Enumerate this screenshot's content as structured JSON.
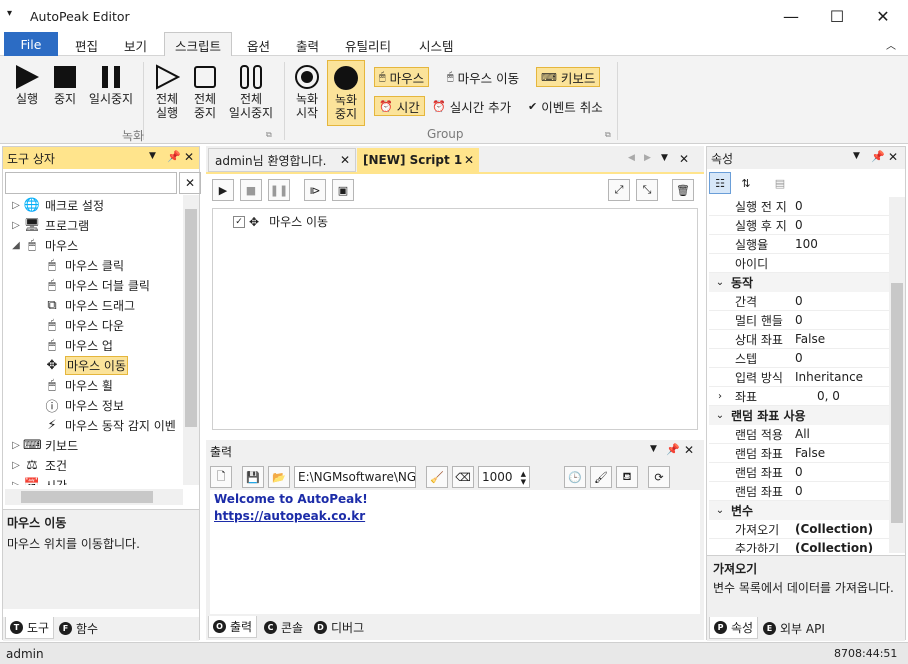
{
  "window": {
    "title": "AutoPeak Editor",
    "minimize": "—",
    "maximize": "☐",
    "close": "✕"
  },
  "menu": {
    "file": "File",
    "items": [
      "편집",
      "보기",
      "스크립트",
      "옵션",
      "출력",
      "유틸리티",
      "시스템"
    ]
  },
  "ribbon": {
    "run": "실행",
    "stop": "중지",
    "pause": "일시중지",
    "run_all": [
      "전체",
      "실행"
    ],
    "stop_all": [
      "전체",
      "중지"
    ],
    "pause_all": [
      "전체",
      "일시중지"
    ],
    "rec_start": [
      "녹화",
      "시작"
    ],
    "rec_stop": [
      "녹화",
      "중지"
    ],
    "group_record": "녹화",
    "mouse": "마우스",
    "mouse_move": "마우스 이동",
    "keyboard": "키보드",
    "time": "시간",
    "realtime_add": "실시간 추가",
    "event_cancel": "이벤트 취소",
    "group_group": "Group"
  },
  "toolbox": {
    "title": "도구 상자",
    "items": [
      {
        "label": "매크로 설정",
        "icon": "globe-icon",
        "level": 0,
        "chev": "▷"
      },
      {
        "label": "프로그램",
        "icon": "program-icon",
        "level": 0,
        "chev": "▷"
      },
      {
        "label": "마우스",
        "icon": "mouse-icon",
        "level": 0,
        "chev": "◢"
      },
      {
        "label": "마우스 클릭",
        "icon": "mouse-click-icon",
        "level": 1
      },
      {
        "label": "마우스 더블 클릭",
        "icon": "mouse-double-click-icon",
        "level": 1
      },
      {
        "label": "마우스 드래그",
        "icon": "mouse-drag-icon",
        "level": 1
      },
      {
        "label": "마우스 다운",
        "icon": "mouse-down-icon",
        "level": 1
      },
      {
        "label": "마우스 업",
        "icon": "mouse-up-icon",
        "level": 1
      },
      {
        "label": "마우스 이동",
        "icon": "move-icon",
        "level": 1,
        "selected": true
      },
      {
        "label": "마우스 휠",
        "icon": "mouse-wheel-icon",
        "level": 1
      },
      {
        "label": "마우스 정보",
        "icon": "mouse-info-icon",
        "level": 1
      },
      {
        "label": "마우스 동작 감지 이벤",
        "icon": "lightning-icon",
        "level": 1
      },
      {
        "label": "키보드",
        "icon": "keyboard-icon",
        "level": 0,
        "chev": "▷"
      },
      {
        "label": "조건",
        "icon": "condition-icon",
        "level": 0,
        "chev": "▷"
      },
      {
        "label": "시간",
        "icon": "calendar-icon",
        "level": 0,
        "chev": "▷"
      }
    ],
    "desc_title": "마우스 이동",
    "desc_text": "마우스 위치를 이동합니다.",
    "tab_tools": "도구",
    "tab_functions": "함수"
  },
  "doc": {
    "tab1": "admin님 환영합니다.",
    "tab2": "[NEW] Script 1",
    "script_item": "마우스 이동"
  },
  "output": {
    "title": "출력",
    "path": "E:\\NGMsoftware\\NG",
    "count": "1000",
    "line1": "Welcome to AutoPeak!",
    "line2": "https://autopeak.co.kr",
    "tab_output": "출력",
    "tab_console": "콘솔",
    "tab_debug": "디버그"
  },
  "properties": {
    "title": "속성",
    "rows": [
      {
        "type": "prop",
        "name": "실행 전 지",
        "value": "0"
      },
      {
        "type": "prop",
        "name": "실행 후 지",
        "value": "0"
      },
      {
        "type": "prop",
        "name": "실행율",
        "value": "100"
      },
      {
        "type": "prop",
        "name": "아이디",
        "value": ""
      },
      {
        "type": "cat",
        "name": "동작"
      },
      {
        "type": "prop",
        "name": "간격",
        "value": "0"
      },
      {
        "type": "prop",
        "name": "멀티 핸들",
        "value": "0"
      },
      {
        "type": "prop",
        "name": "상대 좌표",
        "value": "False"
      },
      {
        "type": "prop",
        "name": "스텝",
        "value": "0"
      },
      {
        "type": "prop",
        "name": "입력 방식",
        "value": "Inheritance"
      },
      {
        "type": "propexp",
        "name": "좌표",
        "value": "0, 0"
      },
      {
        "type": "cat",
        "name": "랜덤 좌표 사용"
      },
      {
        "type": "prop",
        "name": "랜덤 적용",
        "value": "All"
      },
      {
        "type": "prop",
        "name": "랜덤 좌표",
        "value": "False"
      },
      {
        "type": "prop",
        "name": "랜덤 좌표",
        "value": "0"
      },
      {
        "type": "prop",
        "name": "랜덤 좌표",
        "value": "0"
      },
      {
        "type": "cat",
        "name": "변수"
      },
      {
        "type": "propbold",
        "name": "가져오기",
        "value": "(Collection)"
      },
      {
        "type": "propbold",
        "name": "추가하기",
        "value": "(Collection)"
      }
    ],
    "desc_title": "가져오기",
    "desc_text": "변수 목록에서 데이터를 가져옵니다.",
    "tab_props": "속성",
    "tab_api": "외부 API"
  },
  "status": {
    "user": "admin",
    "time": "8708:44:51"
  }
}
